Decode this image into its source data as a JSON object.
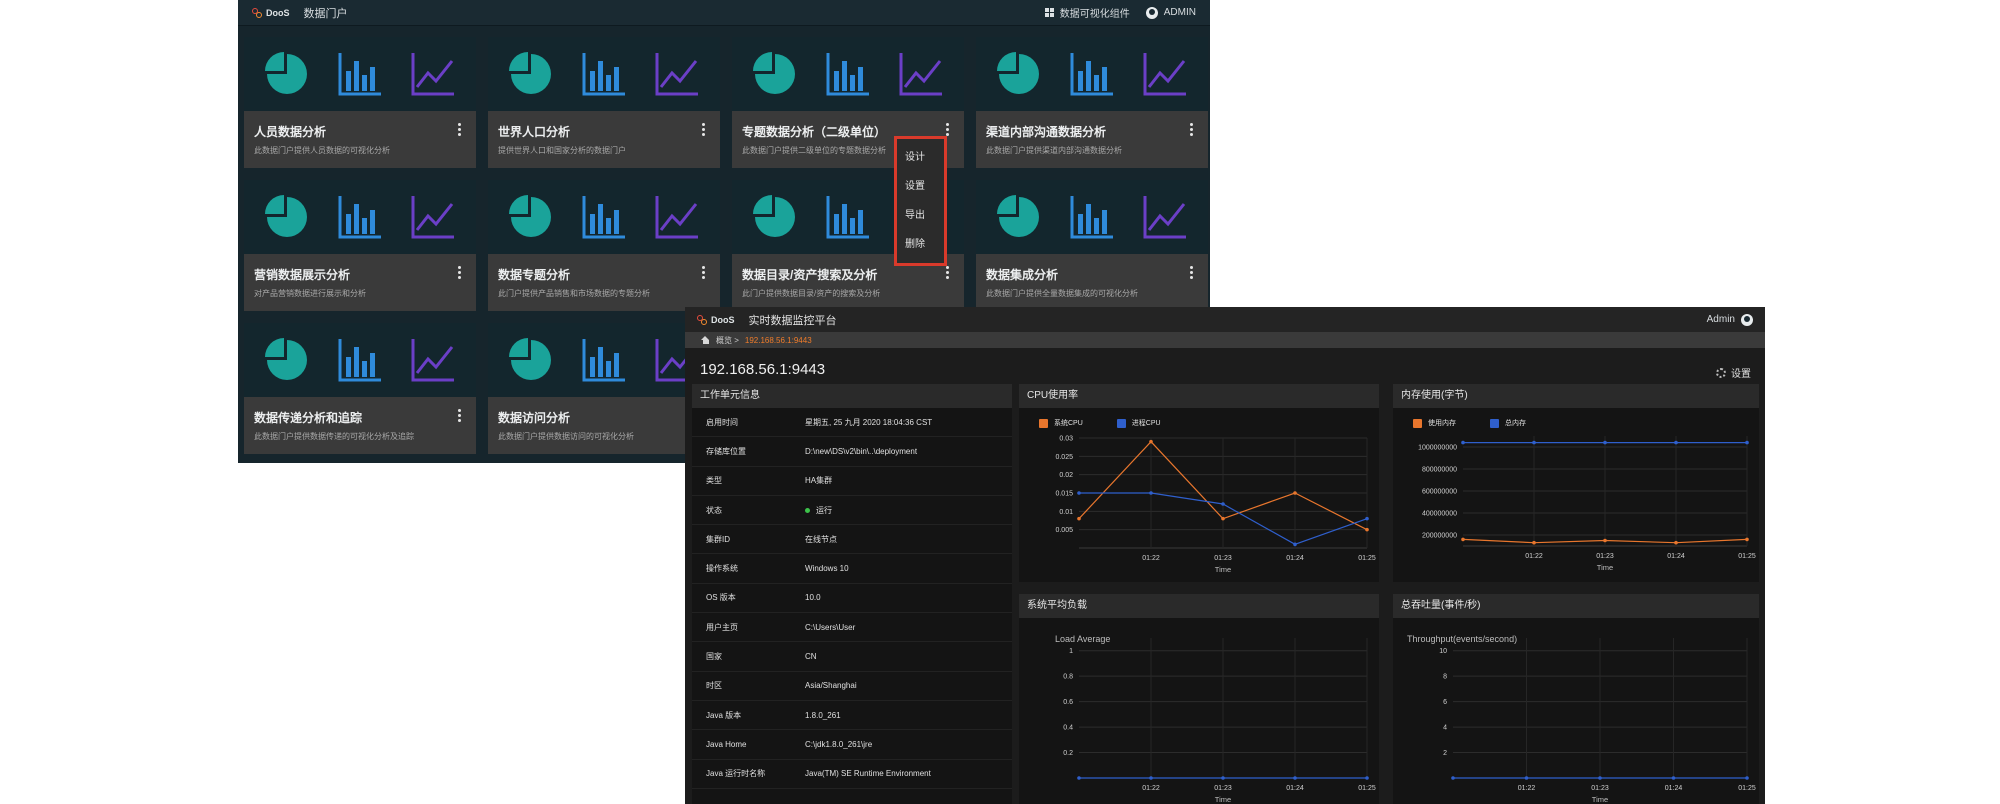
{
  "portal": {
    "logo_text": "DooS",
    "title": "数据门户",
    "widgets_label": "数据可视化组件",
    "user_label": "ADMIN",
    "cards": [
      {
        "title": "人员数据分析",
        "desc": "此数据门户提供人员数据的可视化分析"
      },
      {
        "title": "世界人口分析",
        "desc": "提供世界人口和国家分析的数据门户"
      },
      {
        "title": "专题数据分析（二级单位）",
        "desc": "此数据门户提供二级单位的专题数据分析"
      },
      {
        "title": "渠道内部沟通数据分析",
        "desc": "此数据门户提供渠道内部沟通数据分析"
      },
      {
        "title": "营销数据展示分析",
        "desc": "对产品营销数据进行展示和分析"
      },
      {
        "title": "数据专题分析",
        "desc": "此门户提供产品销售和市场数据的专题分析"
      },
      {
        "title": "数据目录/资产搜索及分析",
        "desc": "此门户提供数据目录/资产的搜索及分析"
      },
      {
        "title": "数据集成分析",
        "desc": "此数据门户提供全量数据集成的可视化分析"
      },
      {
        "title": "数据传递分析和追踪",
        "desc": "此数据门户提供数据传递的可视化分析及追踪"
      },
      {
        "title": "数据访问分析",
        "desc": "此数据门户提供数据访问的可视化分析"
      }
    ],
    "context_menu": [
      "设计",
      "设置",
      "导出",
      "删除"
    ],
    "colors": {
      "pie": "#1aa39a",
      "bar": "#2f8bdb",
      "line": "#6b3fc7",
      "menu_border": "#d93a2b"
    }
  },
  "monitor": {
    "logo_text": "DooS",
    "title": "实时数据监控平台",
    "user_label": "Admin",
    "breadcrumb_root": "概览 >",
    "breadcrumb_current": "192.168.56.1:9443",
    "page_title": "192.168.56.1:9443",
    "settings_label": "设置",
    "info_title": "工作单元信息",
    "info_rows": [
      {
        "k": "启用时间",
        "v": "星期五, 25 九月 2020 18:04:36 CST"
      },
      {
        "k": "存储库位置",
        "v": "D:\\new\\DS\\v2\\bin\\..\\deployment"
      },
      {
        "k": "类型",
        "v": "HA集群"
      },
      {
        "k": "状态",
        "v": "运行"
      },
      {
        "k": "集群ID",
        "v": "在线节点"
      },
      {
        "k": "操作系统",
        "v": "Windows 10"
      },
      {
        "k": "OS 版本",
        "v": "10.0"
      },
      {
        "k": "用户主页",
        "v": "C:\\Users\\User"
      },
      {
        "k": "国家",
        "v": "CN"
      },
      {
        "k": "时区",
        "v": "Asia/Shanghai"
      },
      {
        "k": "Java 版本",
        "v": "1.8.0_261"
      },
      {
        "k": "Java Home",
        "v": "C:\\jdk1.8.0_261\\jre"
      },
      {
        "k": "Java 运行时名称",
        "v": "Java(TM) SE Runtime Environment"
      }
    ],
    "cpu_panel_title": "CPU使用率",
    "mem_panel_title": "内存使用(字节)",
    "load_panel_title": "系统平均负载",
    "thr_panel_title": "总吞吐量(事件/秒)",
    "colors": {
      "orange": "#e8762d",
      "blue": "#2f5fcc",
      "status_ok": "#3cc24a"
    }
  },
  "chart_data": [
    {
      "type": "line",
      "xlabel": "Time",
      "categories": [
        "01:22",
        "01:23",
        "01:24",
        "01:25"
      ],
      "ylim": [
        0,
        0.03
      ],
      "yticks": [
        0.005,
        0.01,
        0.015,
        0.02,
        0.025,
        0.03
      ],
      "x": [
        0,
        1,
        2,
        3,
        4,
        5
      ],
      "series": [
        {
          "name": "系统CPU",
          "color": "#e8762d",
          "values": [
            0.008,
            0.029,
            0.008,
            0.015,
            0.005
          ]
        },
        {
          "name": "进程CPU",
          "color": "#2f5fcc",
          "values": [
            0.015,
            0.015,
            0.012,
            0.001,
            0.008
          ]
        }
      ],
      "grid": true
    },
    {
      "type": "line",
      "xlabel": "Time",
      "categories": [
        "01:22",
        "01:23",
        "01:24",
        "01:25"
      ],
      "ylim": [
        100000000,
        1100000000
      ],
      "yticks": [
        200000000,
        400000000,
        600000000,
        800000000,
        1000000000
      ],
      "series": [
        {
          "name": "使用内存",
          "color": "#e8762d",
          "values": [
            160000000,
            130000000,
            150000000,
            130000000,
            160000000
          ]
        },
        {
          "name": "总内存",
          "color": "#2f5fcc",
          "values": [
            1040000000,
            1040000000,
            1040000000,
            1040000000,
            1040000000
          ]
        }
      ],
      "grid": true
    },
    {
      "type": "line",
      "xlabel": "Time",
      "ylabel": "Load Average",
      "categories": [
        "01:22",
        "01:23",
        "01:24",
        "01:25"
      ],
      "ylim": [
        0,
        1.1
      ],
      "yticks": [
        0.2,
        0.4,
        0.6,
        0.8,
        1
      ],
      "series": [
        {
          "color": "#2f5fcc",
          "values": [
            0,
            0,
            0,
            0,
            0
          ]
        }
      ],
      "grid": true
    },
    {
      "type": "line",
      "xlabel": "Time",
      "ylabel": "Throughput(events/second)",
      "categories": [
        "01:22",
        "01:23",
        "01:24",
        "01:25"
      ],
      "ylim": [
        0,
        11
      ],
      "yticks": [
        2,
        4,
        6,
        8,
        10
      ],
      "series": [
        {
          "color": "#2f5fcc",
          "values": [
            0,
            0,
            0,
            0,
            0
          ]
        }
      ],
      "grid": true
    }
  ]
}
